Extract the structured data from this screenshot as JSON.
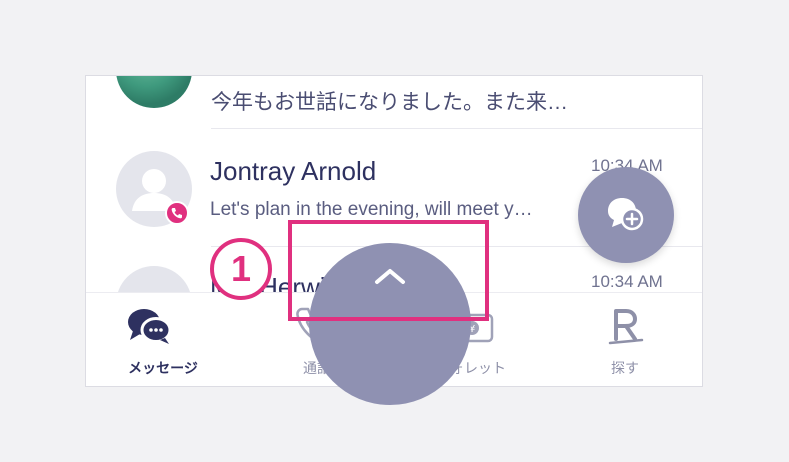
{
  "chat_list": [
    {
      "name": "",
      "preview": "今年もお世話になりました。また来…",
      "time": ""
    },
    {
      "name": "Jontray Arnold",
      "preview": "Let's plan in the evening, will meet y…",
      "time": "10:34 AM"
    },
    {
      "name": "Mia Herwitz",
      "preview": "",
      "time": "10:34 AM"
    }
  ],
  "tabs": [
    {
      "label": "メッセージ",
      "icon": "chat-bubbles-icon",
      "active": true
    },
    {
      "label": "通話",
      "icon": "phone-icon",
      "active": false
    },
    {
      "label": "ウォレット",
      "icon": "wallet-icon",
      "active": false
    },
    {
      "label": "探す",
      "icon": "rakuten-r-icon",
      "active": false
    }
  ],
  "fab_icon": "new-chat-icon",
  "pull_handle_icon": "chevron-up-icon",
  "annotation": {
    "step_number": "1"
  },
  "colors": {
    "accent": "#e0307f",
    "fab": "#8f91b2",
    "text_primary": "#2e3160"
  }
}
